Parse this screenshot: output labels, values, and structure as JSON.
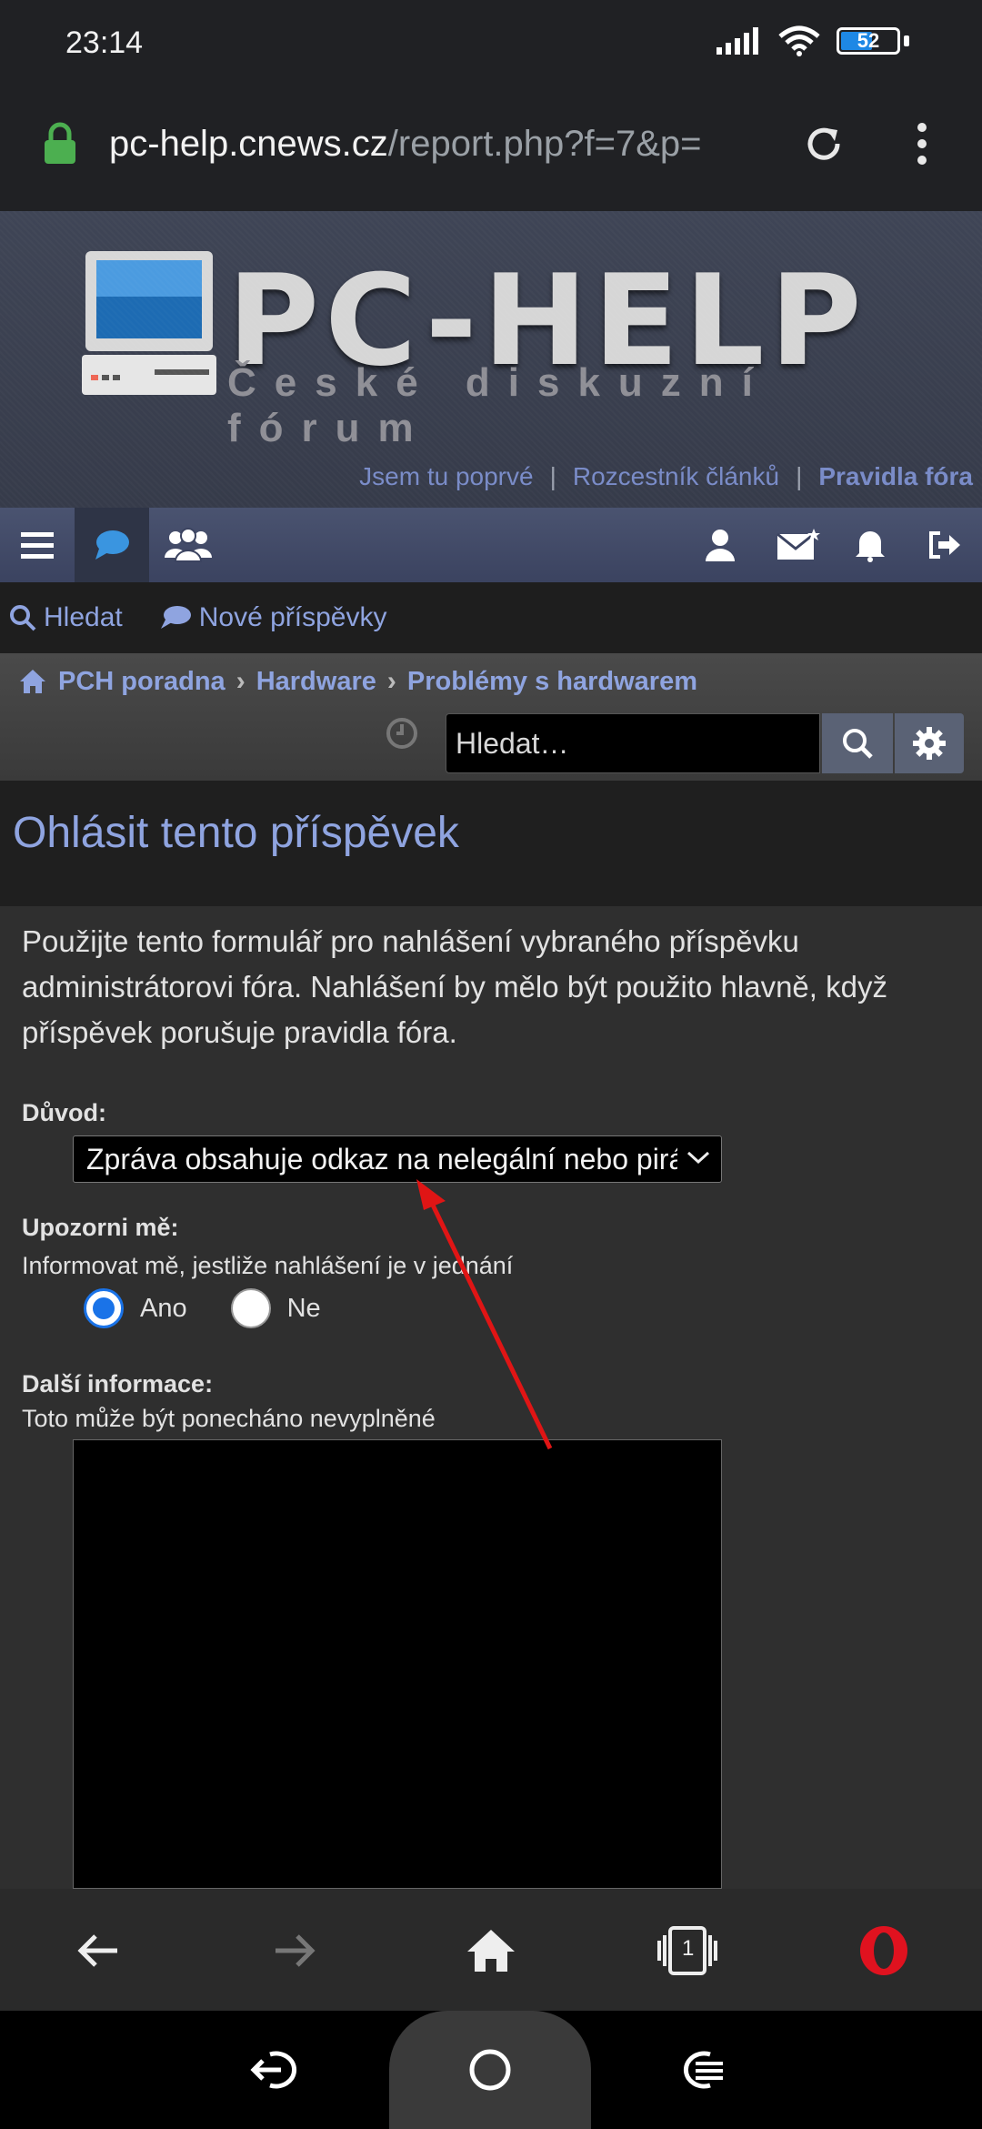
{
  "status_bar": {
    "time": "23:14",
    "battery_level": "52"
  },
  "address_bar": {
    "url_host": "pc-help.cnews.cz",
    "url_path": "/report.php?f=7&p="
  },
  "banner": {
    "logo_title": "PC-HELP",
    "logo_subtitle": "České diskuzní fórum",
    "links": [
      "Jsem tu poprvé",
      "Rozcestník článků",
      "Pravidla fóra"
    ],
    "separator": "|"
  },
  "quicklinks": {
    "search_label": "Hledat",
    "new_posts_label": "Nové příspěvky"
  },
  "breadcrumb": [
    "PCH poradna",
    "Hardware",
    "Problémy s hardwarem"
  ],
  "search": {
    "placeholder": "Hledat…"
  },
  "page": {
    "title": "Ohlásit tento příspěvek"
  },
  "form": {
    "intro": "Použijte tento formulář pro nahlášení vybraného příspěvku administrátorovi fóra. Nahlášení by mělo být použito hlavně, když příspěvek porušuje pravidla fóra.",
    "reason_label": "Důvod:",
    "reason_value": "Zpráva obsahuje odkaz na nelegální nebo pirátský software",
    "notify_label": "Upozorni mě:",
    "notify_help": "Informovat mě, jestliže nahlášení je v jednání",
    "radio_yes": "Ano",
    "radio_no": "Ne",
    "notify_selected": "Ano",
    "more_info_label": "Další informace:",
    "more_info_help": "Toto může být ponecháno nevyplněné",
    "more_info_value": ""
  },
  "browser_bar": {
    "tabs_count": "1"
  },
  "colors": {
    "accent": "#8fa4e0",
    "annotation_arrow": "#e01515",
    "opera_red": "#e0121f"
  }
}
